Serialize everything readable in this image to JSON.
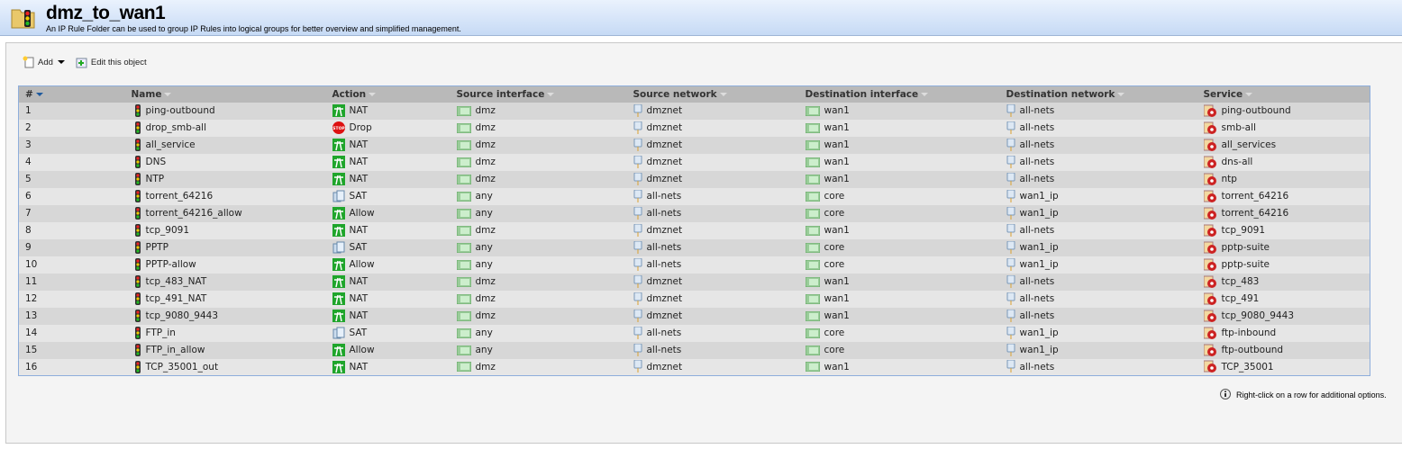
{
  "header": {
    "title": "dmz_to_wan1",
    "subtitle": "An IP Rule Folder can be used to group IP Rules into logical groups for better overview and simplified management."
  },
  "toolbar": {
    "add_label": "Add",
    "edit_label": "Edit this object"
  },
  "table": {
    "columns": [
      "#",
      "Name",
      "Action",
      "Source interface",
      "Source network",
      "Destination interface",
      "Destination network",
      "Service"
    ],
    "rows": [
      [
        "1",
        "ping-outbound",
        "NAT",
        "dmz",
        "dmznet",
        "wan1",
        "all-nets",
        "ping-outbound"
      ],
      [
        "2",
        "drop_smb-all",
        "Drop",
        "dmz",
        "dmznet",
        "wan1",
        "all-nets",
        "smb-all"
      ],
      [
        "3",
        "all_service",
        "NAT",
        "dmz",
        "dmznet",
        "wan1",
        "all-nets",
        "all_services"
      ],
      [
        "4",
        "DNS",
        "NAT",
        "dmz",
        "dmznet",
        "wan1",
        "all-nets",
        "dns-all"
      ],
      [
        "5",
        "NTP",
        "NAT",
        "dmz",
        "dmznet",
        "wan1",
        "all-nets",
        "ntp"
      ],
      [
        "6",
        "torrent_64216",
        "SAT",
        "any",
        "all-nets",
        "core",
        "wan1_ip",
        "torrent_64216"
      ],
      [
        "7",
        "torrent_64216_allow",
        "Allow",
        "any",
        "all-nets",
        "core",
        "wan1_ip",
        "torrent_64216"
      ],
      [
        "8",
        "tcp_9091",
        "NAT",
        "dmz",
        "dmznet",
        "wan1",
        "all-nets",
        "tcp_9091"
      ],
      [
        "9",
        "PPTP",
        "SAT",
        "any",
        "all-nets",
        "core",
        "wan1_ip",
        "pptp-suite"
      ],
      [
        "10",
        "PPTP-allow",
        "Allow",
        "any",
        "all-nets",
        "core",
        "wan1_ip",
        "pptp-suite"
      ],
      [
        "11",
        "tcp_483_NAT",
        "NAT",
        "dmz",
        "dmznet",
        "wan1",
        "all-nets",
        "tcp_483"
      ],
      [
        "12",
        "tcp_491_NAT",
        "NAT",
        "dmz",
        "dmznet",
        "wan1",
        "all-nets",
        "tcp_491"
      ],
      [
        "13",
        "tcp_9080_9443",
        "NAT",
        "dmz",
        "dmznet",
        "wan1",
        "all-nets",
        "tcp_9080_9443"
      ],
      [
        "14",
        "FTP_in",
        "SAT",
        "any",
        "all-nets",
        "core",
        "wan1_ip",
        "ftp-inbound"
      ],
      [
        "15",
        "FTP_in_allow",
        "Allow",
        "any",
        "all-nets",
        "core",
        "wan1_ip",
        "ftp-outbound"
      ],
      [
        "16",
        "TCP_35001_out",
        "NAT",
        "dmz",
        "dmznet",
        "wan1",
        "all-nets",
        "TCP_35001"
      ]
    ]
  },
  "hint": "Right-click on a row for additional options."
}
